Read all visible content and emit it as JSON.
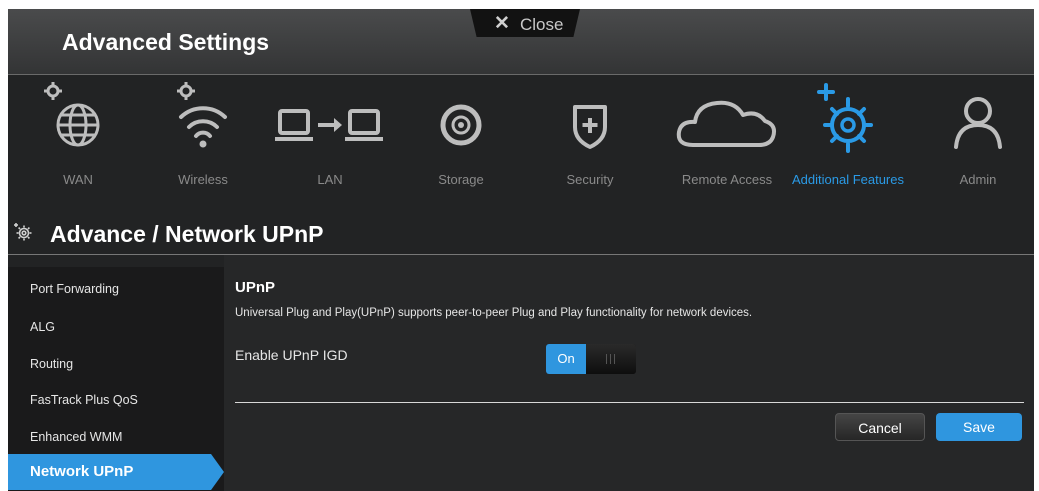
{
  "header": {
    "title": "Advanced Settings",
    "close_label": "Close"
  },
  "nav": [
    {
      "label": "WAN",
      "icon": "globe-icon",
      "active": false
    },
    {
      "label": "Wireless",
      "icon": "wifi-icon",
      "active": false
    },
    {
      "label": "LAN",
      "icon": "lan-icon",
      "active": false
    },
    {
      "label": "Storage",
      "icon": "storage-icon",
      "active": false
    },
    {
      "label": "Security",
      "icon": "shield-icon",
      "active": false
    },
    {
      "label": "Remote Access",
      "icon": "cloud-icon",
      "active": false
    },
    {
      "label": "Additional Features",
      "icon": "gear-plus-icon",
      "active": true
    },
    {
      "label": "Admin",
      "icon": "person-icon",
      "active": false
    }
  ],
  "section": {
    "title": "Advance / Network UPnP"
  },
  "sidebar": {
    "items": [
      {
        "label": "Port Forwarding"
      },
      {
        "label": "ALG"
      },
      {
        "label": "Routing"
      },
      {
        "label": "FasTrack Plus QoS"
      },
      {
        "label": "Enhanced WMM"
      },
      {
        "label": "Network UPnP"
      }
    ]
  },
  "content": {
    "title": "UPnP",
    "description": "Universal Plug and Play(UPnP) supports peer-to-peer Plug and Play functionality for network devices.",
    "setting_label": "Enable UPnP IGD",
    "toggle_state": "On",
    "cancel_label": "Cancel",
    "save_label": "Save"
  },
  "colors": {
    "accent": "#2f96df",
    "background": "#222324",
    "icon_gray": "#bdbdbd"
  }
}
